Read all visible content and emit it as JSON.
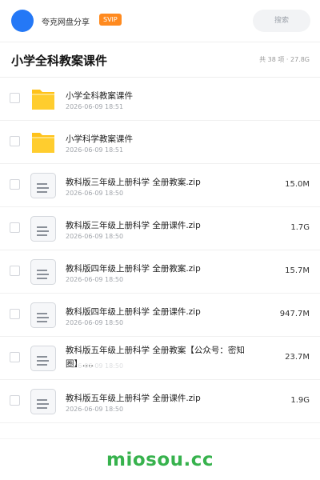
{
  "header": {
    "share_name": "夸克网盘分享",
    "vip_label": "SVIP",
    "search_placeholder": "搜索",
    "avatar_color": "#2478f6",
    "vip_color": "#ff8a1f"
  },
  "folder": {
    "title": "小学全科教案课件",
    "stats": "共 38 项 · 27.8G"
  },
  "files": [
    {
      "icon": "folder-icon",
      "name": "小学全科教案课件",
      "date": "2026-06-09 18:51",
      "size": ""
    },
    {
      "icon": "folder-icon",
      "name": "小学科学教案课件",
      "date": "2026-06-09 18:51",
      "size": ""
    },
    {
      "icon": "document-icon",
      "name": "教科版三年级上册科学 全册教案.zip",
      "date": "2026-06-09 18:50",
      "size": "15.0M"
    },
    {
      "icon": "document-icon",
      "name": "教科版三年级上册科学 全册课件.zip",
      "date": "2026-06-09 18:50",
      "size": "1.7G"
    },
    {
      "icon": "document-icon",
      "name": "教科版四年级上册科学 全册教案.zip",
      "date": "2026-06-09 18:50",
      "size": "15.7M"
    },
    {
      "icon": "document-icon",
      "name": "教科版四年级上册科学 全册课件.zip",
      "date": "2026-06-09 18:50",
      "size": "947.7M"
    },
    {
      "icon": "document-icon",
      "name": "教科版五年级上册科学 全册教案【公众号：密知圈】.…",
      "date": "2026-06-09 18:50",
      "size": "23.7M"
    },
    {
      "icon": "document-icon",
      "name": "教科版五年级上册科学 全册课件.zip",
      "date": "2026-06-09 18:50",
      "size": "1.9G"
    }
  ],
  "footer": {
    "watermark": "miosou.cc",
    "watermark_color": "#37b24d"
  }
}
